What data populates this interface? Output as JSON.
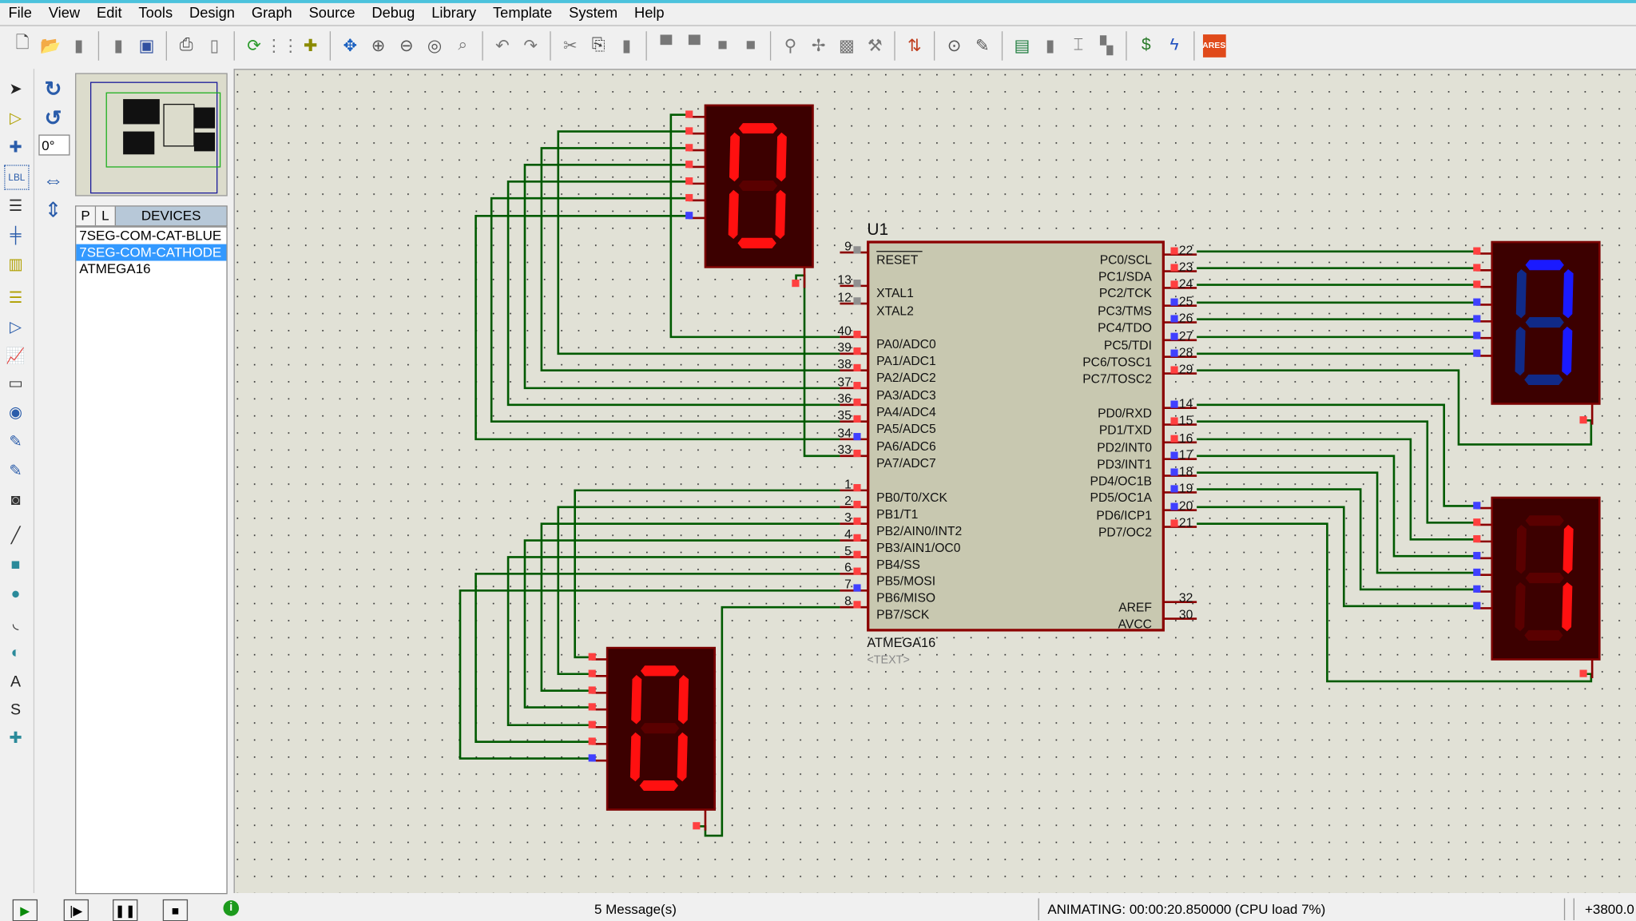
{
  "menu": [
    "File",
    "View",
    "Edit",
    "Tools",
    "Design",
    "Graph",
    "Source",
    "Debug",
    "Library",
    "Template",
    "System",
    "Help"
  ],
  "toolbar_icons": [
    [
      "new-file-icon",
      "open-file-icon",
      "save-icon"
    ],
    [
      "import-icon",
      "export-icon"
    ],
    [
      "print-icon",
      "print-area-icon"
    ],
    [
      "refresh-icon",
      "grid-icon",
      "origin-icon"
    ],
    [
      "pan-icon",
      "zoom-in-icon",
      "zoom-out-icon",
      "zoom-all-icon",
      "zoom-area-icon"
    ],
    [
      "undo-icon",
      "redo-icon"
    ],
    [
      "cut-icon",
      "copy-icon",
      "paste-icon"
    ],
    [
      "block-copy-icon",
      "block-move-icon",
      "block-rotate-icon",
      "block-delete-icon"
    ],
    [
      "pick-device-icon",
      "make-device-icon",
      "package-icon",
      "decompose-icon"
    ],
    [
      "wire-autoroute-icon"
    ],
    [
      "search-icon",
      "property-assign-icon"
    ],
    [
      "new-sheet-icon",
      "remove-sheet-icon",
      "exit-parent-icon",
      "goto-sheet-icon"
    ],
    [
      "bill-of-materials-icon",
      "electrical-rules-icon"
    ],
    [
      "ares-icon"
    ]
  ],
  "ares_label": "ARES",
  "rotation": {
    "angle": "0°"
  },
  "devices": {
    "tab_p": "P",
    "tab_l": "L",
    "header": "DEVICES",
    "items": [
      "7SEG-COM-CAT-BLUE",
      "7SEG-COM-CATHODE",
      "ATMEGA16"
    ],
    "selected_index": 1
  },
  "chip": {
    "ref": "U1",
    "name": "ATMEGA16",
    "text_placeholder": "<TEXT>",
    "left_pins": [
      {
        "num": "9",
        "name": "RESET",
        "state": "none"
      },
      {
        "num": "13",
        "name": "XTAL1",
        "state": "none"
      },
      {
        "num": "12",
        "name": "XTAL2",
        "state": "none"
      },
      {
        "num": "40",
        "name": "PA0/ADC0",
        "state": "high"
      },
      {
        "num": "39",
        "name": "PA1/ADC1",
        "state": "high"
      },
      {
        "num": "38",
        "name": "PA2/ADC2",
        "state": "high"
      },
      {
        "num": "37",
        "name": "PA3/ADC3",
        "state": "high"
      },
      {
        "num": "36",
        "name": "PA4/ADC4",
        "state": "high"
      },
      {
        "num": "35",
        "name": "PA5/ADC5",
        "state": "high"
      },
      {
        "num": "34",
        "name": "PA6/ADC6",
        "state": "low"
      },
      {
        "num": "33",
        "name": "PA7/ADC7",
        "state": "high"
      },
      {
        "num": "1",
        "name": "PB0/T0/XCK",
        "state": "high"
      },
      {
        "num": "2",
        "name": "PB1/T1",
        "state": "high"
      },
      {
        "num": "3",
        "name": "PB2/AIN0/INT2",
        "state": "high"
      },
      {
        "num": "4",
        "name": "PB3/AIN1/OC0",
        "state": "high"
      },
      {
        "num": "5",
        "name": "PB4/SS",
        "state": "high"
      },
      {
        "num": "6",
        "name": "PB5/MOSI",
        "state": "high"
      },
      {
        "num": "7",
        "name": "PB6/MISO",
        "state": "low"
      },
      {
        "num": "8",
        "name": "PB7/SCK",
        "state": "high"
      }
    ],
    "right_pins": [
      {
        "num": "22",
        "name": "PC0/SCL",
        "state": "high"
      },
      {
        "num": "23",
        "name": "PC1/SDA",
        "state": "high"
      },
      {
        "num": "24",
        "name": "PC2/TCK",
        "state": "high"
      },
      {
        "num": "25",
        "name": "PC3/TMS",
        "state": "low"
      },
      {
        "num": "26",
        "name": "PC4/TDO",
        "state": "low"
      },
      {
        "num": "27",
        "name": "PC5/TDI",
        "state": "low"
      },
      {
        "num": "28",
        "name": "PC6/TOSC1",
        "state": "low"
      },
      {
        "num": "29",
        "name": "PC7/TOSC2",
        "state": "high"
      },
      {
        "num": "14",
        "name": "PD0/RXD",
        "state": "low"
      },
      {
        "num": "15",
        "name": "PD1/TXD",
        "state": "high"
      },
      {
        "num": "16",
        "name": "PD2/INT0",
        "state": "high"
      },
      {
        "num": "17",
        "name": "PD3/INT1",
        "state": "low"
      },
      {
        "num": "18",
        "name": "PD4/OC1B",
        "state": "low"
      },
      {
        "num": "19",
        "name": "PD5/OC1A",
        "state": "low"
      },
      {
        "num": "20",
        "name": "PD6/ICP1",
        "state": "low"
      },
      {
        "num": "21",
        "name": "PD7/OC2",
        "state": "high"
      },
      {
        "num": "32",
        "name": "AREF",
        "state": "none"
      },
      {
        "num": "30",
        "name": "AVCC",
        "state": "none"
      }
    ]
  },
  "displays": [
    {
      "id": "top-left",
      "color": "red",
      "digit": "0",
      "segments": "1111110",
      "pin_states": [
        "high",
        "high",
        "high",
        "high",
        "high",
        "high",
        "low"
      ],
      "common": "high"
    },
    {
      "id": "bottom-left",
      "color": "red",
      "digit": "0",
      "segments": "1111110",
      "pin_states": [
        "high",
        "high",
        "high",
        "high",
        "high",
        "high",
        "low"
      ],
      "common": "high"
    },
    {
      "id": "top-right",
      "color": "blue",
      "digit": "7",
      "segments": "1110000",
      "pin_states": [
        "high",
        "high",
        "high",
        "low",
        "low",
        "low",
        "low"
      ],
      "common": "high"
    },
    {
      "id": "bottom-right",
      "color": "red",
      "digit": "1",
      "segments": "0110000",
      "pin_states": [
        "low",
        "high",
        "high",
        "low",
        "low",
        "low",
        "low"
      ],
      "common": "high"
    }
  ],
  "colors": {
    "high": "#ff4040",
    "low": "#4040ff",
    "none": "#909090",
    "wire": "#005a00",
    "pin": "#8b0000",
    "red_on": "#ff1010",
    "red_off": "#5a0000",
    "blue_on": "#1a1aff",
    "blue_off": "#102a88",
    "display_bg": "#3c0000",
    "canvas": "#e1e1d6"
  },
  "status": {
    "messages": "5 Message(s)",
    "animating": "ANIMATING: 00:00:20.850000 (CPU load 7%)",
    "coords": "+3800.0"
  }
}
